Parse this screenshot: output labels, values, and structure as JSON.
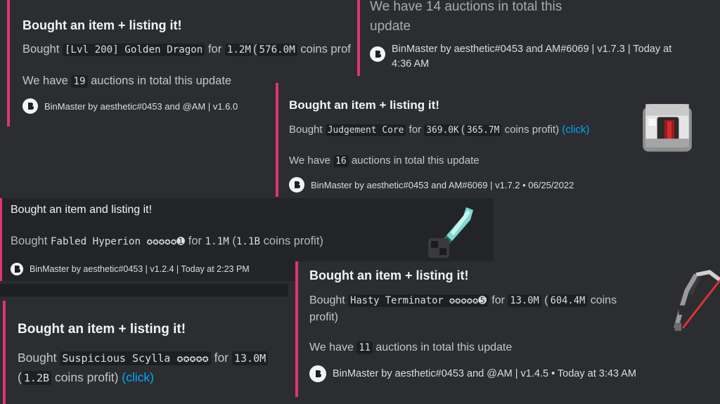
{
  "embed_a": {
    "title": "Bought an item + listing it!",
    "bought": "Bought",
    "item": "[Lvl 200] Golden Dragon",
    "for": "for",
    "price": "1.2M",
    "paren_open": "(",
    "profit": "576.0M",
    "profit_suffix": "coins profit",
    "total_prefix": "We have",
    "total": "19",
    "total_suffix": "auctions in total this update",
    "footer": "BinMaster by aesthetic#0453 and @AM | v1.6.0"
  },
  "embed_b": {
    "total_line_1": "We have 14 auctions in total this",
    "total_line_2": "update",
    "footer_1": "BinMaster by aesthetic#0453 and AM#6069 | v1.7.3 | Today at",
    "footer_2": "4:36 AM"
  },
  "embed_c": {
    "title": "Bought an item + listing it!",
    "bought": "Bought",
    "item": "Judgement Core",
    "for": "for",
    "price": "369.0K",
    "paren_open": "(",
    "profit": "365.7M",
    "profit_suffix": "coins profit)",
    "link": "(click)",
    "total_prefix": "We have",
    "total": "16",
    "total_suffix": "auctions in total this update",
    "footer": "BinMaster by aesthetic#0453 and AM#6069 | v1.7.2 • 06/25/2022",
    "thumbnail": "judgement-core-item"
  },
  "embed_d": {
    "title": "Bought an item and listing it!",
    "bought": "Bought",
    "item": "Fabled Hyperion ✪✪✪✪✪➊",
    "for": "for",
    "price": "1.1M",
    "paren_open": "(",
    "profit": "1.1B",
    "profit_suffix": "coins profit)",
    "footer": "BinMaster by aesthetic#0453 | v1.2.4 | Today at 2:23 PM",
    "thumbnail": "hyperion-sword-item"
  },
  "embed_e": {
    "title": "Bought an item + listing it!",
    "bought": "Bought",
    "item": "Suspicious Scylla ✪✪✪✪✪",
    "for": "for",
    "price": "13.0M",
    "paren_open": "(",
    "profit": "1.2B",
    "profit_suffix": "coins profit)",
    "link": "(click)"
  },
  "embed_f": {
    "title": "Bought an item + listing it!",
    "bought": "Bought",
    "item": "Hasty Terminator ✪✪✪✪✪➎",
    "for": "for",
    "price": "13.0M",
    "paren_open": "(",
    "profit": "604.4M",
    "profit_suffix_1": "coins",
    "profit_suffix_2": "profit)",
    "total_prefix": "We have",
    "total": "11",
    "total_suffix": "auctions in total this update",
    "footer": "BinMaster by aesthetic#0453 and @AM | v1.4.5 • Today at 3:43 AM",
    "thumbnail": "terminator-bow-item"
  },
  "colors": {
    "accent": "#e0356e",
    "link": "#00a8fc",
    "bg": "#2b2d31"
  }
}
